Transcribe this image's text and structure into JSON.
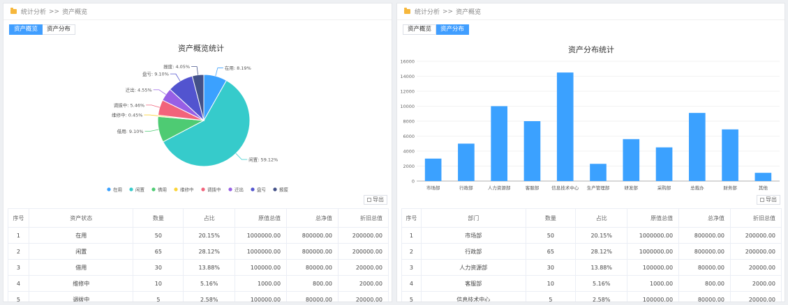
{
  "left": {
    "breadcrumb": {
      "part1": "统计分析",
      "sep": ">>",
      "part2": "资产概览"
    },
    "tabs": [
      {
        "label": "资产概览",
        "active": true
      },
      {
        "label": "资产分布",
        "active": false
      }
    ],
    "export_label": "导出",
    "table": {
      "headers": [
        "序号",
        "资产状态",
        "数量",
        "占比",
        "原值总值",
        "总净值",
        "折旧总值"
      ],
      "rows": [
        [
          "1",
          "在用",
          "50",
          "20.15%",
          "1000000.00",
          "800000.00",
          "200000.00"
        ],
        [
          "2",
          "闲置",
          "65",
          "28.12%",
          "1000000.00",
          "800000.00",
          "200000.00"
        ],
        [
          "3",
          "借用",
          "30",
          "13.88%",
          "100000.00",
          "80000.00",
          "20000.00"
        ],
        [
          "4",
          "维修中",
          "10",
          "5.16%",
          "1000.00",
          "800.00",
          "2000.00"
        ],
        [
          "5",
          "调拨中",
          "5",
          "2.58%",
          "100000.00",
          "80000.00",
          "20000.00"
        ]
      ]
    }
  },
  "right": {
    "breadcrumb": {
      "part1": "统计分析",
      "sep": ">>",
      "part2": "资产概览"
    },
    "tabs": [
      {
        "label": "资产概览",
        "active": false
      },
      {
        "label": "资产分布",
        "active": true
      }
    ],
    "export_label": "导出",
    "table": {
      "headers": [
        "序号",
        "部门",
        "数量",
        "占比",
        "原值总值",
        "总净值",
        "折旧总值"
      ],
      "rows": [
        [
          "1",
          "市场部",
          "50",
          "20.15%",
          "1000000.00",
          "800000.00",
          "200000.00"
        ],
        [
          "2",
          "行政部",
          "65",
          "28.12%",
          "1000000.00",
          "800000.00",
          "200000.00"
        ],
        [
          "3",
          "人力资源部",
          "30",
          "13.88%",
          "100000.00",
          "80000.00",
          "20000.00"
        ],
        [
          "4",
          "客服部",
          "10",
          "5.16%",
          "1000.00",
          "800.00",
          "2000.00"
        ],
        [
          "5",
          "信息技术中心",
          "5",
          "2.58%",
          "100000.00",
          "80000.00",
          "20000.00"
        ]
      ]
    }
  },
  "chart_data": [
    {
      "type": "pie",
      "title": "资产概览统计",
      "legend_placement": "bottom",
      "slices": [
        {
          "name": "在用",
          "label": "在用: 8.19%",
          "value": 8.19,
          "color": "#3ba1ff"
        },
        {
          "name": "闲置",
          "label": "闲置: 59.12%",
          "value": 59.12,
          "color": "#36cbcb"
        },
        {
          "name": "借用",
          "label": "借用: 9.10%",
          "value": 9.1,
          "color": "#4ecb73"
        },
        {
          "name": "维修中",
          "label": "维修中: 0.45%",
          "value": 0.45,
          "color": "#fbd437"
        },
        {
          "name": "调拨中",
          "label": "调拨中: 5.46%",
          "value": 5.46,
          "color": "#f2637b"
        },
        {
          "name": "迁出",
          "label": "迁出: 4.55%",
          "value": 4.55,
          "color": "#975fe5"
        },
        {
          "name": "盘亏",
          "label": "盘亏: 9.10%",
          "value": 9.1,
          "color": "#5254cf"
        },
        {
          "name": "报废",
          "label": "报废: 4.05%",
          "value": 4.05,
          "color": "#435188"
        }
      ]
    },
    {
      "type": "bar",
      "title": "资产分布统计",
      "categories": [
        "市场部",
        "行政部",
        "人力资源部",
        "客服部",
        "信息技术中心",
        "生产管理部",
        "研发部",
        "采购部",
        "总裁办",
        "财务部",
        "其他"
      ],
      "values": [
        3000,
        5000,
        10000,
        8000,
        14500,
        2300,
        5600,
        4500,
        9100,
        6900,
        1100
      ],
      "yticks": [
        "0",
        "2000",
        "4000",
        "6000",
        "8000",
        "10000",
        "12000",
        "14000",
        "16000"
      ],
      "ylim": [
        0,
        16000
      ],
      "grid": true,
      "color": "#3ba1ff"
    }
  ]
}
